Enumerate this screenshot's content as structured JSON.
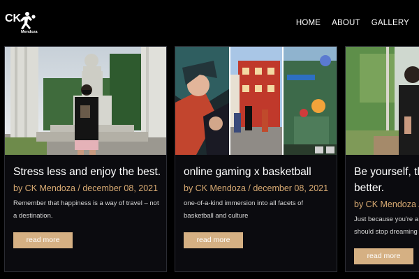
{
  "header": {
    "logo": {
      "line1": "CK",
      "line2": "Mendoza"
    },
    "nav": {
      "home": "HOME",
      "about": "ABOUT",
      "gallery": "GALLERY"
    }
  },
  "posts": [
    {
      "title": "Stress less and enjoy the best.",
      "meta": "by CK Mendoza / december 08, 2021",
      "excerpt": "Remember that happiness is a way of travel – not a destination.",
      "button": "read more"
    },
    {
      "title": "online gaming x basketball",
      "meta": "by CK Mendoza / december 08, 2021",
      "excerpt": "one-of-a-kind immersion into all facets of basketball and culture",
      "button": "read more"
    },
    {
      "title_line1": "Be yourself, th",
      "title_line2": "better.",
      "meta": "by CK Mendoza / d",
      "excerpt": "Just because you're a should stop dreaming",
      "button": "read more"
    }
  ],
  "colors": {
    "background": "#000000",
    "card": "#0b0b0f",
    "accent": "#d9ab73",
    "button": "#d5b083"
  }
}
